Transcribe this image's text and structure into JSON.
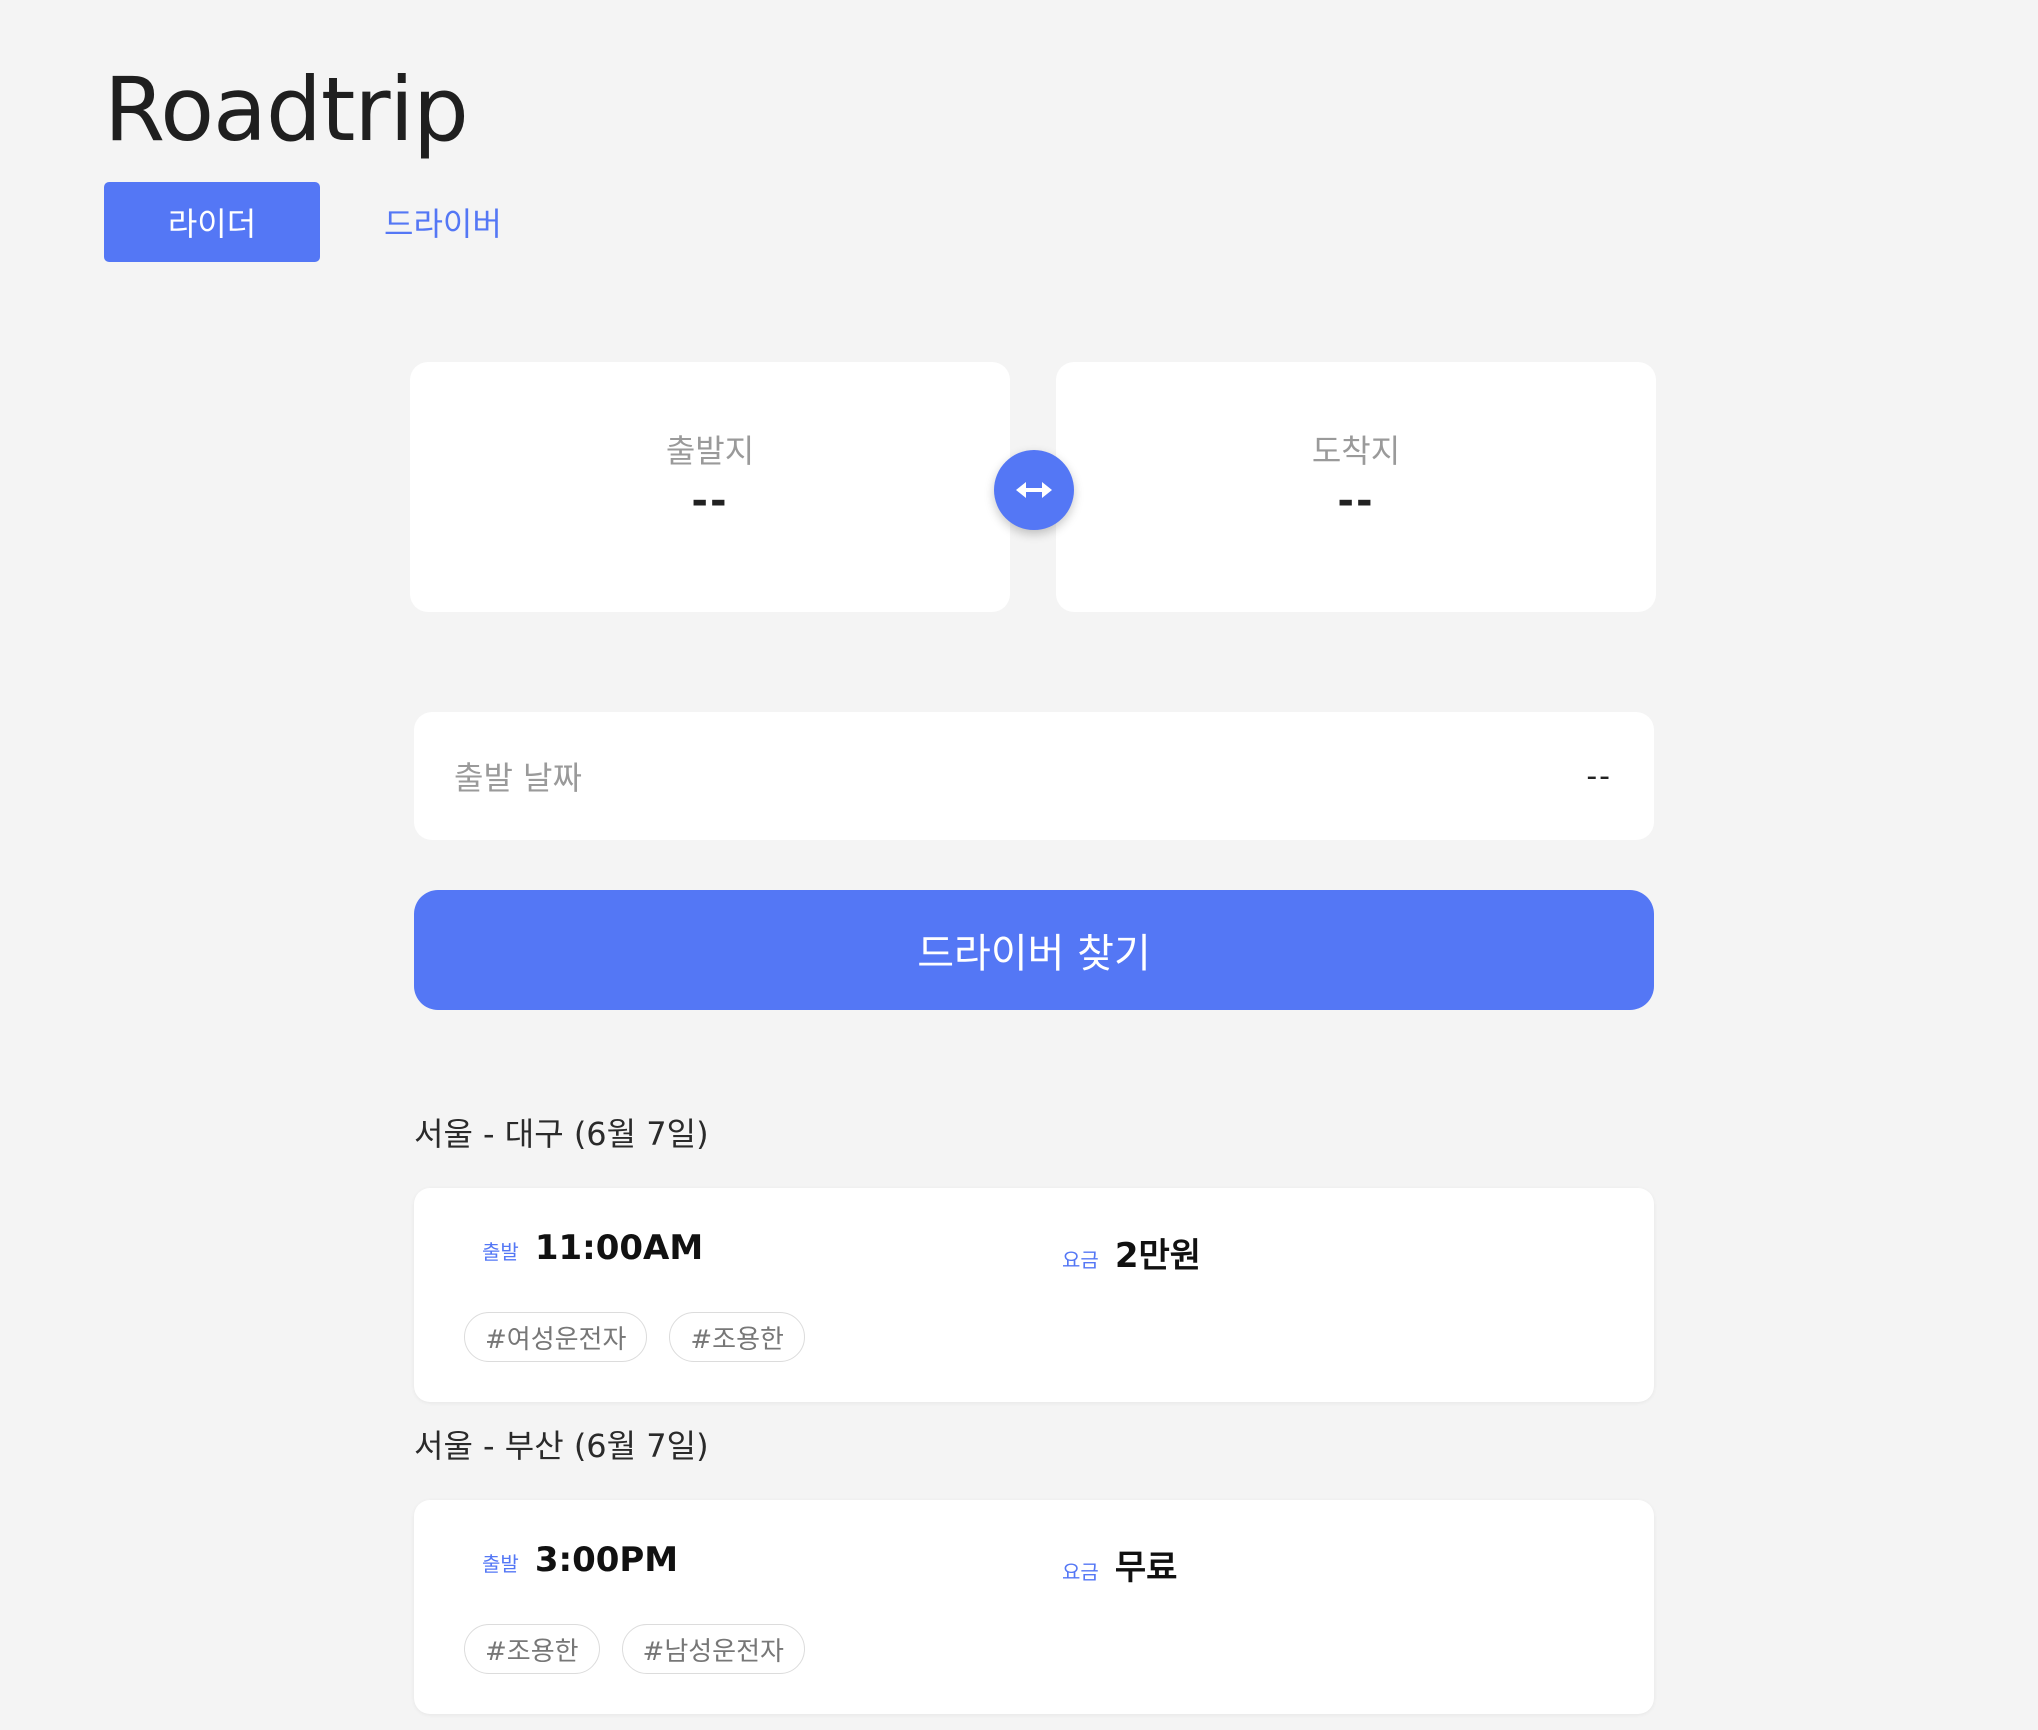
{
  "app": {
    "title": "Roadtrip"
  },
  "tabs": {
    "rider": "라이더",
    "driver": "드라이버"
  },
  "route": {
    "from": {
      "label": "출발지",
      "value": "--"
    },
    "to": {
      "label": "도착지",
      "value": "--"
    }
  },
  "date": {
    "label": "출발 날짜",
    "value": "--"
  },
  "search_button": "드라이버 찾기",
  "results": [
    {
      "heading": "서울 - 대구 (6월 7일)",
      "depart_label": "출발",
      "depart_time": "11:00AM",
      "fare_label": "요금",
      "fare": "2만원",
      "tags": [
        "#여성운전자",
        "#조용한"
      ]
    },
    {
      "heading": "서울 - 부산 (6월 7일)",
      "depart_label": "출발",
      "depart_time": "3:00PM",
      "fare_label": "요금",
      "fare": "무료",
      "tags": [
        "#조용한",
        "#남성운전자"
      ]
    }
  ],
  "colors": {
    "accent": "#5477f5",
    "background": "#f4f4f4"
  },
  "icons": {
    "swap": "swap-horizontal-arrow-icon"
  }
}
